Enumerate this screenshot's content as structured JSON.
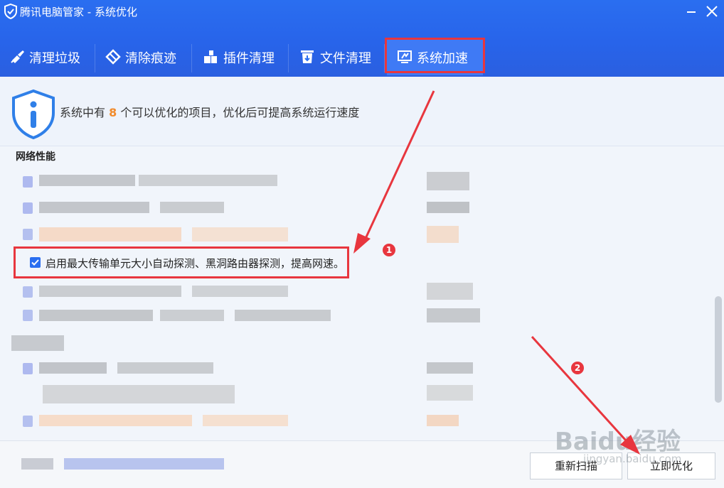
{
  "window": {
    "title": "腾讯电脑管家 - 系统优化"
  },
  "tabs": [
    {
      "label": "清理垃圾",
      "icon": "broom-icon"
    },
    {
      "label": "清除痕迹",
      "icon": "eraser-icon"
    },
    {
      "label": "插件清理",
      "icon": "plugin-icon"
    },
    {
      "label": "文件清理",
      "icon": "file-trash-icon"
    },
    {
      "label": "系统加速",
      "icon": "monitor-speed-icon",
      "active": true
    }
  ],
  "summary": {
    "prefix": "系统中有",
    "count": "8",
    "suffix": "个可以优化的项目，优化后可提高系统运行速度"
  },
  "section": {
    "title": "网络性能"
  },
  "highlighted_item": {
    "label": "启用最大传输单元大小自动探测、黑洞路由器探测，提高网速。",
    "checked": true
  },
  "annotations": {
    "marker_1": "1",
    "marker_2": "2"
  },
  "footer": {
    "rescan_label": "重新扫描",
    "optimize_label": "立即优化"
  },
  "watermark": {
    "text": "Baidu经验",
    "url": "jingyan.baidu.com"
  },
  "colors": {
    "header_blue": "#2a6ef0",
    "highlight_red": "#e8363e",
    "count_orange": "#f18b2c"
  }
}
